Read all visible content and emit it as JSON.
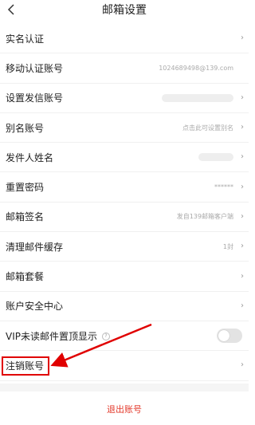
{
  "header": {
    "title": "邮箱设置",
    "back_icon": "chevron-left-icon"
  },
  "rows": [
    {
      "label": "实名认证",
      "value": "",
      "kind": "chevron"
    },
    {
      "label": "移动认证账号",
      "value": "1024689498@139.com",
      "kind": "value"
    },
    {
      "label": "设置发信账号",
      "value": "",
      "kind": "blur-chevron"
    },
    {
      "label": "别名账号",
      "value": "点击此可设置别名",
      "kind": "value-chevron"
    },
    {
      "label": "发件人姓名",
      "value": "",
      "kind": "blur-chevron"
    },
    {
      "label": "重置密码",
      "value": "******",
      "kind": "value-chevron"
    },
    {
      "label": "邮箱签名",
      "value": "发自139邮箱客户端",
      "kind": "value-chevron"
    },
    {
      "label": "清理邮件缓存",
      "value": "1封",
      "kind": "value-chevron"
    },
    {
      "label": "邮箱套餐",
      "value": "",
      "kind": "chevron"
    },
    {
      "label": "账户安全中心",
      "value": "",
      "kind": "chevron"
    },
    {
      "label": "VIP未读邮件置顶显示",
      "value": "",
      "kind": "toggle",
      "toggle_on": false
    },
    {
      "label": "注销账号",
      "value": "",
      "kind": "chevron"
    }
  ],
  "chevron_glyph": "›",
  "help_glyph": "?",
  "logout_label": "退出账号",
  "colors": {
    "accent_red": "#e33a2c",
    "annotation_red": "#e00000"
  }
}
